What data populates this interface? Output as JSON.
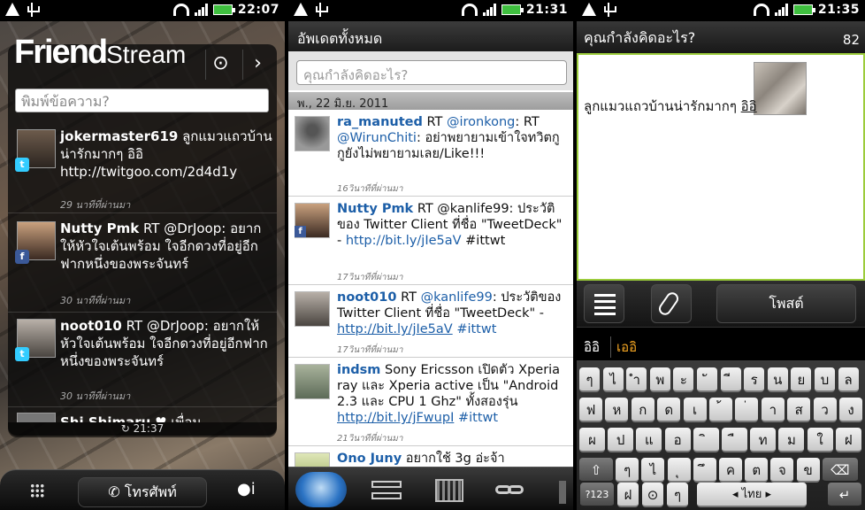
{
  "panel1": {
    "clock": "22:07",
    "logo_bold": "Friend",
    "logo_light": "Stream",
    "location_icon": "location-pin-icon",
    "next_icon": "chevron-right-icon",
    "input_placeholder": "พิมพ์ข้อความ?",
    "items": [
      {
        "user": "jokermaster619",
        "text": "ลูกแมวแถวบ้านน่ารักมากๆ อิอิ http://twitgoo.com/2d4d1y",
        "time": "29 นาทีที่ผ่านมา",
        "source": "twitter"
      },
      {
        "user": "Nutty Pmk",
        "text": "RT @DrJoop: อยากให้หัวใจเต้นพร้อม ใจอีกดวงที่อยู่อีกฟากหนึ่งของพระจันทร์",
        "time": "30 นาทีที่ผ่านมา",
        "source": "facebook"
      },
      {
        "user": "noot010",
        "text": "RT @DrJoop: อยากให้หัวใจเต้นพร้อม ใจอีกดวงที่อยู่อีกฟากหนึ่งของพระจันทร์",
        "time": "30 นาทีที่ผ่านมา",
        "source": "twitter"
      },
      {
        "user": "Shi Shimaru",
        "text": "♥ เพื่อน",
        "time": "",
        "source": "twitter"
      }
    ],
    "footer_time": "21:37",
    "phone_label": "โทรศัพท์"
  },
  "panel2": {
    "clock": "21:31",
    "header": "อัพเดตทั้งหมด",
    "input_placeholder": "คุณกำลังคิดอะไร?",
    "date": "พ., 22 มิ.ย. 2011",
    "tweets": [
      {
        "user": "ra_manuted",
        "pre": "RT ",
        "mention": "@ironkong",
        "mid": ": RT ",
        "mention2": "@WirunChiti",
        "rest": ": อย่าพยายามเข้าใจทวิตกู กูยังไม่พยายามเลย/Like!!!",
        "link": "",
        "tag": "",
        "time": "16วินาทีที่ผ่านมา"
      },
      {
        "user": "Nutty Pmk",
        "pre": "RT @kanlife99: ประวัติของ Twitter Client ที่ชื่อ \"TweetDeck\" - ",
        "mention": "",
        "mid": "",
        "mention2": "",
        "rest": "",
        "link": "http://bit.ly/jIe5aV",
        "tag": "#ittwt",
        "time": "17วินาทีที่ผ่านมา"
      },
      {
        "user": "noot010",
        "pre": "RT ",
        "mention": "@kanlife99",
        "mid": ": ประวัติของ Twitter Client ที่ชื่อ \"TweetDeck\" - ",
        "mention2": "",
        "rest": "",
        "link": "http://bit.ly/jIe5aV",
        "tag": "#ittwt",
        "time": "17วินาทีที่ผ่านมา"
      },
      {
        "user": "indsm",
        "pre": "Sony Ericsson เปิดตัว Xperia ray และ Xperia active เป็น \"Android 2.3 และ CPU 1 Ghz\" ทั้งสองรุ่น ",
        "mention": "",
        "mid": "",
        "mention2": "",
        "rest": "",
        "link": "http://bit.ly/jFwupI",
        "tag": "#ittwt",
        "time": "21วินาทีที่ผ่านมา"
      },
      {
        "user": "Ono Juny",
        "pre": "อยากใช้ 3g อ่ะจ้า",
        "mention": "",
        "mid": "",
        "mention2": "",
        "rest": "",
        "link": "",
        "tag": "",
        "time": ""
      }
    ]
  },
  "panel3": {
    "clock": "21:35",
    "header": "คุณกำลังคิดอะไร?",
    "char_count": "82",
    "compose_text": "ลูกแมวแถวบ้านน่ารักมากๆ ",
    "compose_underlined": "อิอิ",
    "post_label": "โพสต์",
    "suggestion_1": "อิอิ",
    "suggestion_2": "เออิ",
    "keys_row1": [
      "ๆ",
      "ไ",
      "ำ",
      "พ",
      "ะ",
      "ั",
      "ี",
      "ร",
      "น",
      "ย",
      "บ",
      "ล",
      "ฃ"
    ],
    "keys_row2": [
      "ฟ",
      "ห",
      "ก",
      "ด",
      "เ",
      "้",
      "่",
      "า",
      "ส",
      "ว",
      "ง"
    ],
    "keys_row3": [
      "ผ",
      "ป",
      "แ",
      "อ",
      "ิ",
      "ื",
      "ท",
      "ม",
      "ใ",
      "ฝ"
    ],
    "keys_row4": [
      "ๆ",
      "ไ",
      "ุ",
      "ึ",
      "ค",
      "ต",
      "จ",
      "ข",
      "ช"
    ],
    "key_123": "?123",
    "key_space": "ไทย",
    "key_slash": "ฝ"
  }
}
